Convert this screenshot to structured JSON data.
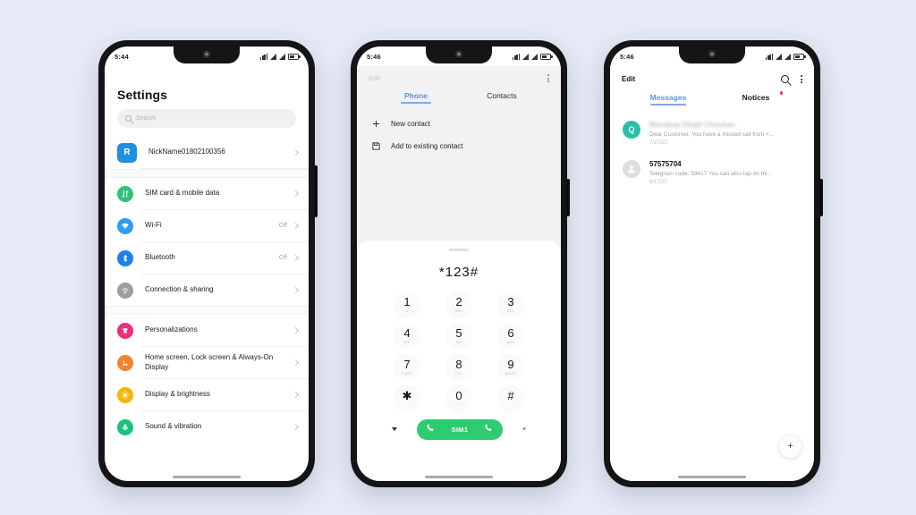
{
  "background_color": "#e6eaf6",
  "phones": {
    "settings": {
      "status": {
        "time": "5:44"
      },
      "title": "Settings",
      "search": {
        "placeholder": "Search"
      },
      "account": {
        "avatar_letter": "R",
        "name": "NickName01802100356"
      },
      "group1": [
        {
          "label": "SIM card & mobile data",
          "value": "",
          "icon": "sim-card-icon",
          "color": "#2ec27e"
        },
        {
          "label": "Wi-Fi",
          "value": "Off",
          "icon": "wifi-icon",
          "color": "#2f9cf4"
        },
        {
          "label": "Bluetooth",
          "value": "Off",
          "icon": "bluetooth-icon",
          "color": "#1f7ef0"
        },
        {
          "label": "Connection & sharing",
          "value": "",
          "icon": "connection-sharing-icon",
          "color": "#9e9e9e"
        }
      ],
      "group2": [
        {
          "label": "Personalizations",
          "value": "",
          "icon": "personalization-icon",
          "color": "#ef2e7b"
        },
        {
          "label": "Home screen, Lock screen & Always-On Display",
          "value": "",
          "icon": "home-screen-icon",
          "color": "#f5822c"
        },
        {
          "label": "Display & brightness",
          "value": "",
          "icon": "brightness-icon",
          "color": "#f7b500"
        },
        {
          "label": "Sound & vibration",
          "value": "",
          "icon": "sound-vibration-icon",
          "color": "#18c47c"
        }
      ]
    },
    "dialer": {
      "status": {
        "time": "5:46"
      },
      "edit_label": "Edit",
      "menu_icon": "kebab-menu-icon",
      "tabs": [
        {
          "label": "Phone",
          "active": true
        },
        {
          "label": "Contacts",
          "active": false
        }
      ],
      "actions": [
        {
          "label": "New contact",
          "icon": "plus-icon"
        },
        {
          "label": "Add to existing contact",
          "icon": "save-contact-icon"
        }
      ],
      "dialed_number": "*123#",
      "keys": [
        {
          "digit": "1",
          "sub": "∞"
        },
        {
          "digit": "2",
          "sub": "ABC"
        },
        {
          "digit": "3",
          "sub": "DEF"
        },
        {
          "digit": "4",
          "sub": "GHI"
        },
        {
          "digit": "5",
          "sub": "JKL"
        },
        {
          "digit": "6",
          "sub": "MNO"
        },
        {
          "digit": "7",
          "sub": "PQRS"
        },
        {
          "digit": "8",
          "sub": "TUV"
        },
        {
          "digit": "9",
          "sub": "WXYZ"
        },
        {
          "digit": "✱",
          "sub": ","
        },
        {
          "digit": "0",
          "sub": "+"
        },
        {
          "digit": "#",
          "sub": ";"
        }
      ],
      "call_button": {
        "label": "SIM1",
        "color": "#2ecc71"
      },
      "delete_label": "×",
      "expand_icon": "chevron-down-icon"
    },
    "messages": {
      "status": {
        "time": "5:46"
      },
      "edit_label": "Edit",
      "search_icon": "search-icon",
      "menu_icon": "kebab-menu-icon",
      "tabs": [
        {
          "label": "Messages",
          "active": true,
          "badge": false
        },
        {
          "label": "Notices",
          "active": false,
          "badge": true
        }
      ],
      "items": [
        {
          "avatar_letter": "Q",
          "avatar_color": "#2bbfa8",
          "name": "Mandeep Singh Chouhan",
          "preview": "Dear Customer, You have a missed call from +...",
          "date": "7/27/22",
          "blurred": true
        },
        {
          "avatar_letter": "",
          "avatar_color": "#dedede",
          "name": "57575704",
          "preview": "Telegram code: 59417  You can also tap on thi...",
          "date": "6/17/22",
          "blurred": false
        }
      ],
      "fab": {
        "icon": "plus-icon",
        "label": "+"
      }
    }
  }
}
